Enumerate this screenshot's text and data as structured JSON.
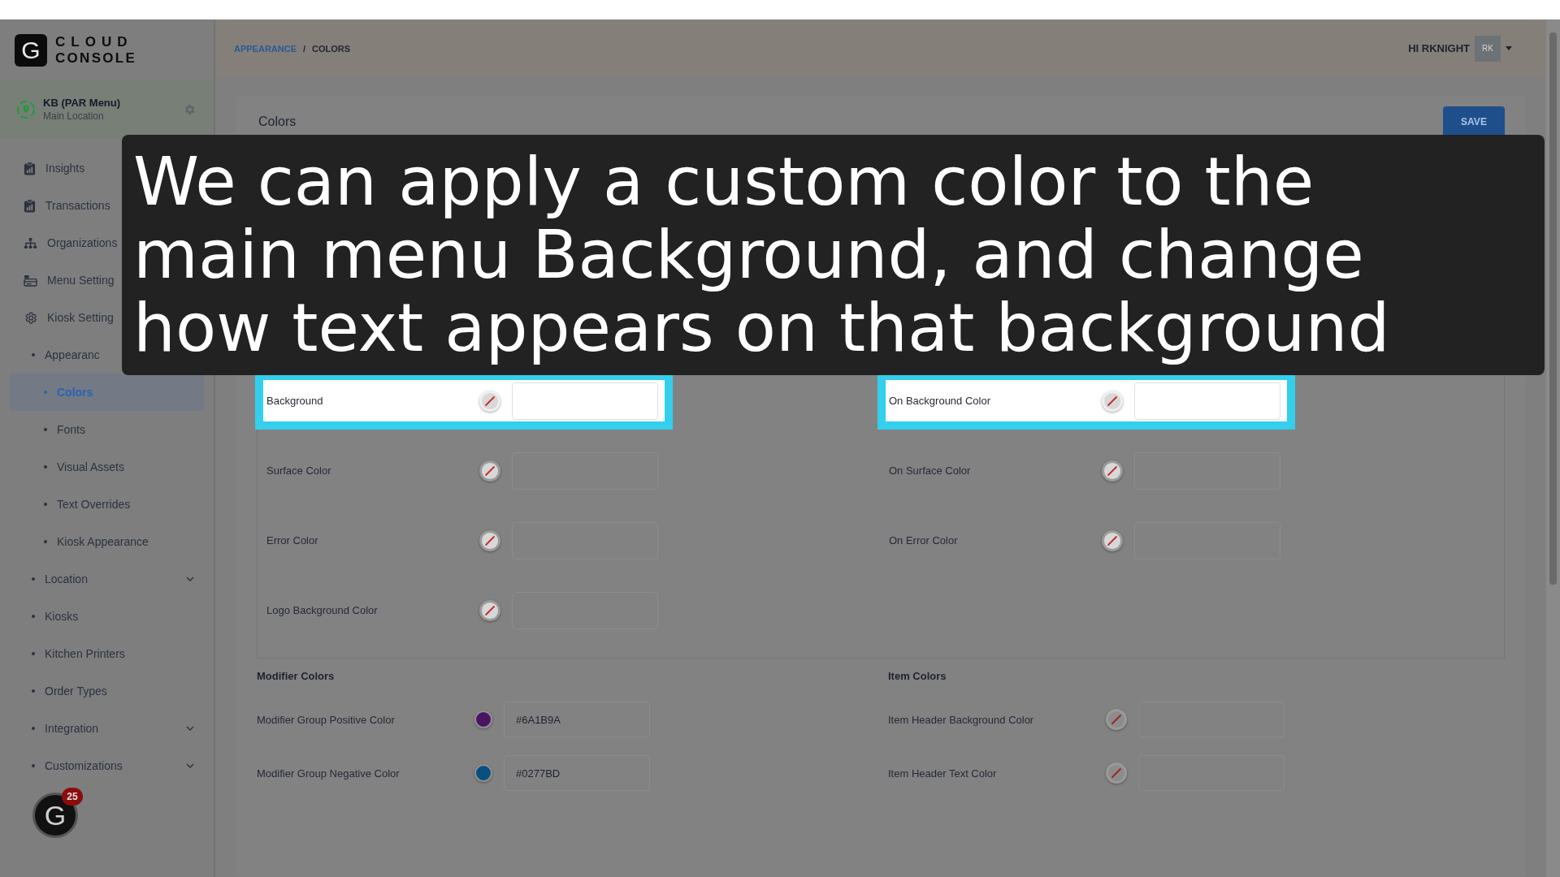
{
  "brand": {
    "mark": "G",
    "line1": "CLOUD",
    "line2": "CONSOLE"
  },
  "location": {
    "name": "KB (PAR Menu)",
    "subtitle": "Main Location"
  },
  "sidebar": {
    "items": [
      {
        "label": "Insights",
        "kind": "report",
        "selected": false
      },
      {
        "label": "Transactions",
        "kind": "report",
        "selected": false
      },
      {
        "label": "Organizations",
        "kind": "hierarchy",
        "selected": false
      },
      {
        "label": "Menu Setting",
        "kind": "card",
        "selected": false
      },
      {
        "label": "Kiosk Setting",
        "kind": "gear",
        "selected": false,
        "children": [
          {
            "label": "Appearanc",
            "kind": "bullet",
            "selected": false,
            "children": [
              {
                "label": "Colors",
                "kind": "bullet",
                "selected": true
              },
              {
                "label": "Fonts",
                "kind": "bullet",
                "selected": false
              },
              {
                "label": "Visual Assets",
                "kind": "bullet",
                "selected": false
              },
              {
                "label": "Text Overrides",
                "kind": "bullet",
                "selected": false
              },
              {
                "label": "Kiosk Appearance",
                "kind": "bullet",
                "selected": false
              }
            ]
          },
          {
            "label": "Location",
            "kind": "bullet",
            "selected": false,
            "expanded": false
          },
          {
            "label": "Kiosks",
            "kind": "bullet",
            "selected": false
          },
          {
            "label": "Kitchen Printers",
            "kind": "bullet",
            "selected": false
          },
          {
            "label": "Order Types",
            "kind": "bullet",
            "selected": false
          },
          {
            "label": "Integration",
            "kind": "bullet",
            "selected": false,
            "expanded": false
          },
          {
            "label": "Customizations",
            "kind": "bullet",
            "selected": false,
            "expanded": false
          }
        ]
      }
    ]
  },
  "breadcrumb": {
    "separator": "/",
    "items": [
      {
        "label": "APPEARANCE",
        "kind": "link"
      },
      {
        "label": "COLORS",
        "kind": "current"
      }
    ]
  },
  "user": {
    "greeting": "HI RKNIGHT",
    "initials": "RK"
  },
  "colors_card": {
    "title": "Colors",
    "save_button": "SAVE",
    "left_fields": [
      {
        "label": "Background",
        "highlighted": true
      },
      {
        "label": "Surface Color",
        "highlighted": false
      },
      {
        "label": "Error Color",
        "highlighted": false
      },
      {
        "label": "Logo Background Color",
        "highlighted": false
      }
    ],
    "right_fields": [
      {
        "label": "On Background Color",
        "highlighted": true
      },
      {
        "label": "On Surface Color",
        "highlighted": false
      },
      {
        "label": "On Error Color",
        "highlighted": false
      }
    ]
  },
  "modifier_colors": {
    "title": "Modifier Colors",
    "fields": [
      {
        "label": "Modifier Group Positive Color",
        "color": "#4a1464",
        "value": "#6A1B9A"
      },
      {
        "label": "Modifier Group Negative Color",
        "color": "#08507e",
        "value": "#0277BD"
      }
    ]
  },
  "item_colors": {
    "title": "Item Colors",
    "fields": [
      {
        "label": "Item Header Background Color"
      },
      {
        "label": "Item Header Text Color"
      }
    ]
  },
  "caption": "We can apply a custom color to the main menu Background, and change how text appears on that background",
  "chat": {
    "mark": "G",
    "badge": "25"
  }
}
